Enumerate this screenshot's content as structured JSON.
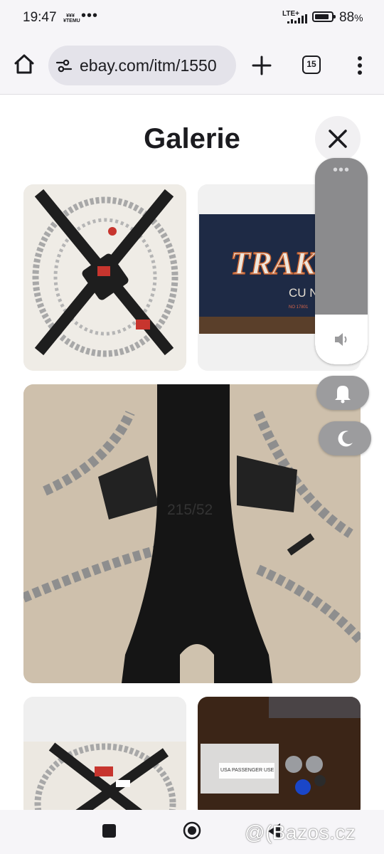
{
  "status_bar": {
    "time": "19:47",
    "temu_badge": "¥¥¥¥TEMU",
    "more": "•••",
    "network": "LTE+",
    "battery_percent": "88",
    "battery_symbol": "%",
    "battery_level": 0.88
  },
  "toolbar": {
    "url": "ebay.com/itm/1550",
    "tab_count": "15"
  },
  "gallery": {
    "title": "Galerie",
    "images": [
      {
        "name": "thumb-1",
        "subject": "snow chains top view"
      },
      {
        "name": "thumb-2",
        "subject": "blue bag with TRAK logo",
        "text": "TRAK",
        "subtext": "CU NA",
        "small_text": "NO 17801"
      },
      {
        "name": "image-main",
        "subject": "chain spider arm",
        "text": "215/52"
      },
      {
        "name": "thumb-4",
        "subject": "snow chains top view"
      },
      {
        "name": "thumb-5",
        "subject": "bolts and packets",
        "text": "USA PASSENGER USE"
      }
    ]
  },
  "volume_panel": {
    "more": "•••",
    "level": 0.24
  },
  "watermark": "@(Bazos.cz",
  "colors": {
    "background": "#f6f5f8",
    "url_bar": "#e4e3ea",
    "panel": "#8b8b8d",
    "pill": "#9c9c9e"
  }
}
